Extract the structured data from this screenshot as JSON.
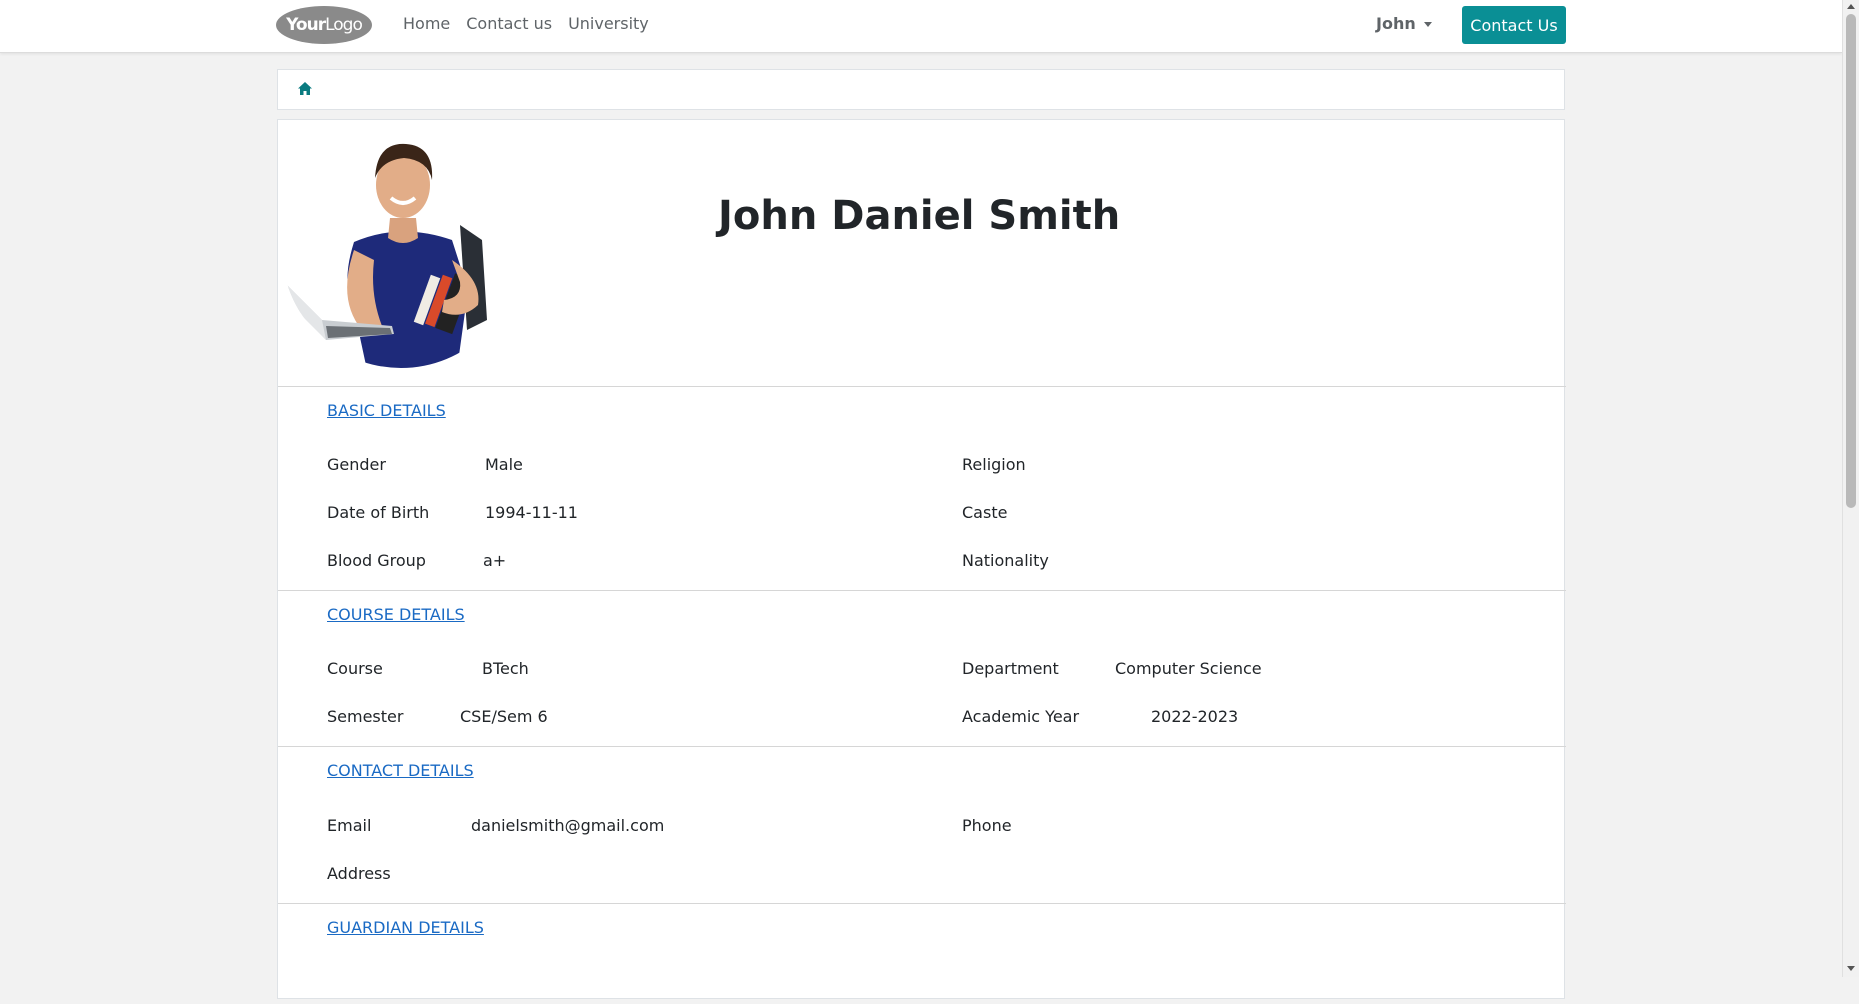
{
  "nav": {
    "logo_text_a": "Your",
    "logo_text_b": "Logo",
    "links": [
      "Home",
      "Contact us",
      "University"
    ],
    "user": "John",
    "contact_button": "Contact Us"
  },
  "profile": {
    "name": "John Daniel Smith"
  },
  "basic": {
    "title": "BASIC DETAILS",
    "gender_label": "Gender",
    "gender": "Male",
    "dob_label": "Date of Birth",
    "dob": "1994-11-11",
    "blood_label": "Blood Group",
    "blood": "a+",
    "religion_label": "Religion",
    "caste_label": "Caste",
    "nationality_label": "Nationality"
  },
  "course": {
    "title": "COURSE DETAILS",
    "course_label": "Course",
    "course": "BTech",
    "semester_label": "Semester",
    "semester": "CSE/Sem 6",
    "department_label": "Department",
    "department": "Computer Science",
    "year_label": "Academic Year",
    "year": "2022-2023"
  },
  "contact": {
    "title": "CONTACT DETAILS",
    "email_label": "Email",
    "email": "danielsmith@gmail.com",
    "phone_label": "Phone",
    "address_label": "Address"
  },
  "guardian": {
    "title": "GUARDIAN DETAILS"
  },
  "colors": {
    "accent": "#0a8f95",
    "link": "#1a6ac4"
  }
}
